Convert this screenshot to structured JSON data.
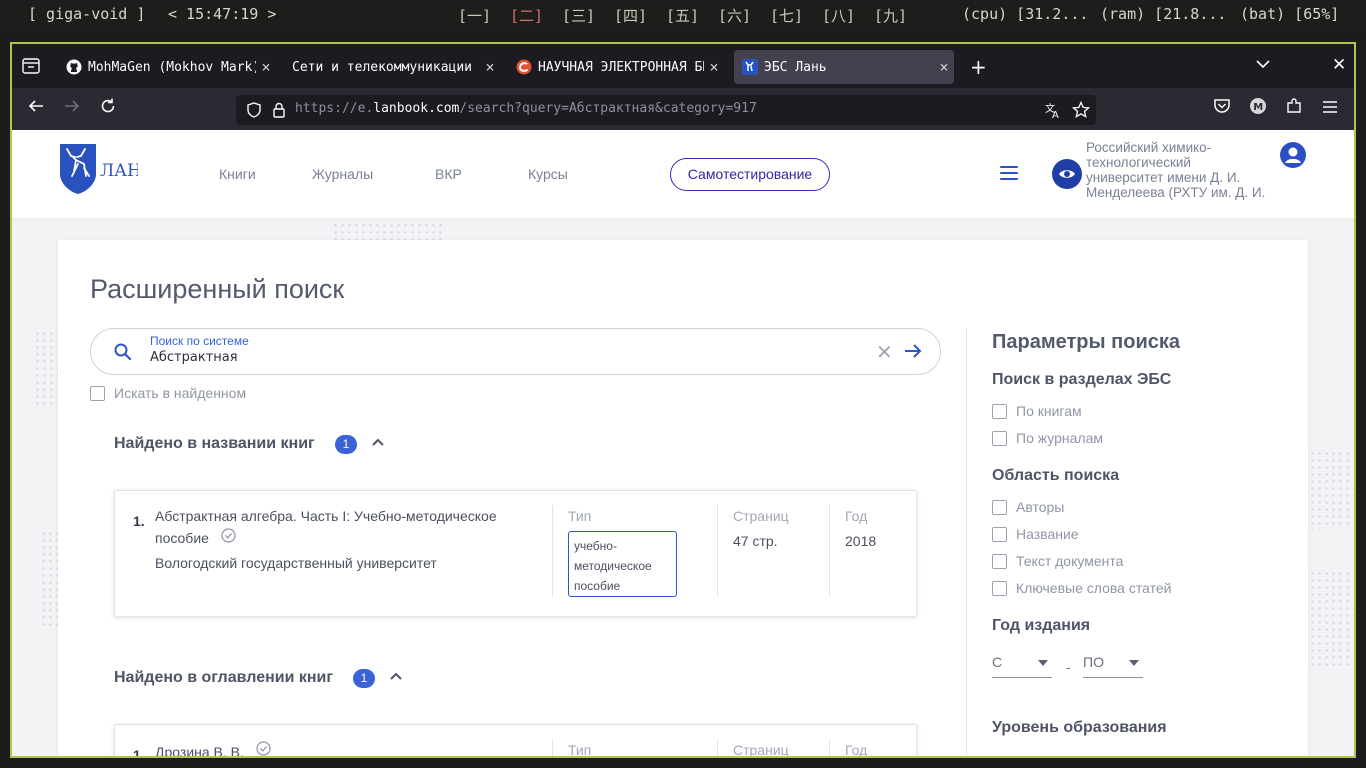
{
  "system_bar": {
    "hostname": "[ giga-void ]",
    "clock": "< 15:47:19 >",
    "workspaces": [
      "[一]",
      "[二]",
      "[三]",
      "[四]",
      "[五]",
      "[六]",
      "[七]",
      "[八]",
      "[九]"
    ],
    "active_workspace_index": 1,
    "cpu": "(cpu) [31.2...",
    "ram": "(ram) [21.8...",
    "battery": "(bat) [65%]"
  },
  "browser": {
    "tabs": [
      {
        "label": "MohMaGen (Mokhov Mark)",
        "icon": "github-icon",
        "active": false
      },
      {
        "label": "Сети и телекоммуникации КС",
        "icon": "none",
        "active": false
      },
      {
        "label": "НАУЧНАЯ ЭЛЕКТРОННАЯ БИБ",
        "icon": "elibrary-icon",
        "active": false
      },
      {
        "label": "ЭБС Лань",
        "icon": "lan-favicon",
        "active": true
      }
    ],
    "url_prefix": "https://e.",
    "url_domain": "lanbook.com",
    "url_rest": "/search?query=Абстрактная&category=917"
  },
  "header": {
    "logo_text": "ЛАНЬ",
    "nav": [
      "Книги",
      "Журналы",
      "ВКР",
      "Курсы"
    ],
    "selftest_label": "Самотестирование",
    "org_name": "Российский химико-технологический университет имени Д. И. Менделеева (РХТУ им. Д. И. Менделеева)"
  },
  "search": {
    "title": "Расширенный поиск",
    "label": "Поиск по системе",
    "value": "Абстрактная",
    "in_found_label": "Искать в найденном"
  },
  "results": {
    "sections": [
      {
        "title": "Найдено в названии книг",
        "count": "1",
        "items": [
          {
            "num": "1.",
            "title": "Абстрактная алгебра. Часть I: Учебно-методическое пособие",
            "publisher": "Вологодский государственный университет",
            "type_head": "Тип",
            "type": "учебно-методическое пособие",
            "pages_head": "Страниц",
            "pages": "47 стр.",
            "year_head": "Год",
            "year": "2018"
          }
        ]
      },
      {
        "title": "Найдено в оглавлении книг",
        "count": "1",
        "items": [
          {
            "num": "1.",
            "title": "Дрозина В. В.",
            "type_head": "Тип",
            "pages_head": "Страниц",
            "year_head": "Год"
          }
        ]
      }
    ]
  },
  "params": {
    "title": "Параметры поиска",
    "sections_head": "Поиск в разделах ЭБС",
    "sections_opts": [
      "По книгам",
      "По журналам"
    ],
    "area_head": "Область поиска",
    "area_opts": [
      "Авторы",
      "Название",
      "Текст документа",
      "Ключевые слова статей"
    ],
    "year_head": "Год издания",
    "year_from": "С",
    "year_dash": "-",
    "year_to": "ПО",
    "level_head": "Уровень образования"
  },
  "colors": {
    "accent": "#3a63d8",
    "brand_purple": "#4a22b8",
    "window_border": "#b7c24c",
    "active_workspace": "#e06a6a"
  }
}
